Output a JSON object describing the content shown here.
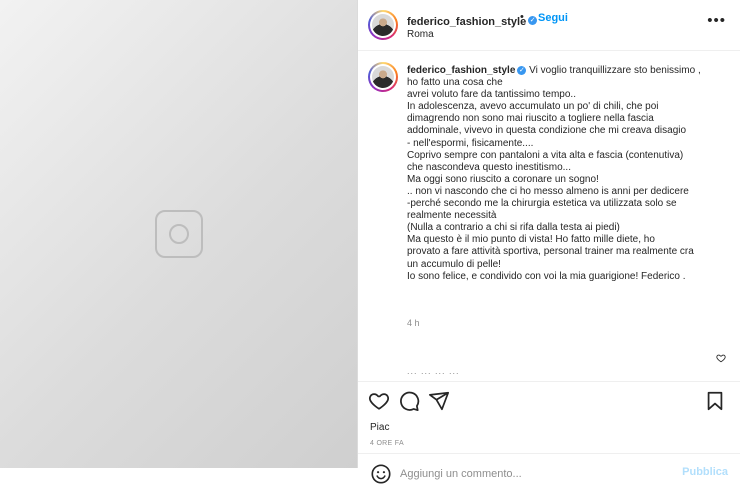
{
  "post": {
    "username": "federico_fashion_style",
    "verified": true,
    "follow_label": "Segui",
    "separator": "•",
    "location": "Roma",
    "more_icon": "more-horizontal-icon",
    "media_icon": "image-icon"
  },
  "caption": {
    "lines": [
      "Vi voglio tranquillizzare sto benissimo ,",
      "ho fatto una cosa che",
      "avrei voluto fare da tantissimo tempo..",
      "In adolescenza, avevo accumulato un po' di chili, che poi",
      "dimagrendo non sono mai riuscito a togliere nella fascia",
      "addominale, vivevo in questa condizione che mi creava disagio",
      "- nell'espormi, fisicamente....",
      "Coprivo sempre con pantaloni a vita alta e fascia (contenutiva)",
      "che nascondeva questo inestitismo...",
      "Ma oggi sono riuscito a coronare un sogno!",
      ".. non vi nascondo che ci ho messo almeno is anni per dedicere",
      "-perché secondo me la chirurgia estetica va utilizzata solo se",
      "realmente necessità",
      "(Nulla a contrario a chi si rifa dalla testa ai piedi)",
      "Ma questo è il mio punto di vista! Ho fatto mille diete, ho",
      "provato a fare attività sportiva, personal trainer ma realmente cra",
      "un accumulo di pelle!",
      "Io sono felice, e condivido con voi la mia guarigione! Federico ."
    ],
    "timestamp": "4 h",
    "truncated_next": "... ... ... ..."
  },
  "actions": {
    "like_icon": "heart-icon",
    "comment_icon": "comment-icon",
    "share_icon": "paper-plane-icon",
    "save_icon": "bookmark-icon"
  },
  "likes_text": "Piac",
  "time_ago": "4 ORE FA",
  "comment": {
    "placeholder": "Aggiungi un commento...",
    "value": "",
    "publish_label": "Pubblica",
    "emoji_icon": "emoji-icon"
  },
  "colors": {
    "accent": "#0095f6",
    "verified": "#3897f0",
    "publish_disabled": "#b2dffc",
    "muted": "#8e8e8e",
    "text": "#262626",
    "border": "#dbdbdb"
  }
}
